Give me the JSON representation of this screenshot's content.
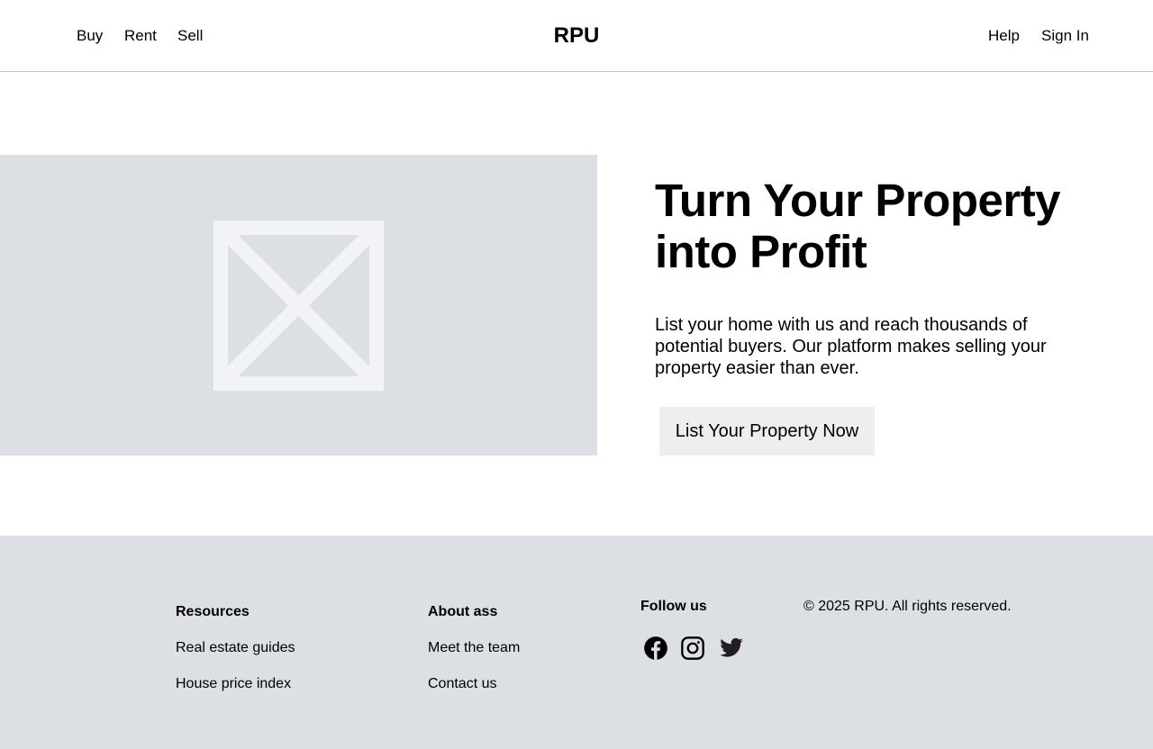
{
  "header": {
    "nav_left": [
      "Buy",
      "Rent",
      "Sell"
    ],
    "logo": "RPU",
    "nav_right": [
      "Help",
      "Sign In"
    ]
  },
  "hero": {
    "image_icon": "image-placeholder-icon",
    "title_line1": "Turn Your Property",
    "title_line2": "into Profit",
    "description": "List your home with us and reach thousands of potential buyers. Our platform makes selling your property easier than ever.",
    "cta_label": "List Your Property Now"
  },
  "footer": {
    "resources": {
      "heading": "Resources",
      "links": [
        "Real estate guides",
        "House price index"
      ]
    },
    "about": {
      "heading": "About ass",
      "links": [
        "Meet the team",
        "Contact us"
      ]
    },
    "follow": {
      "heading": "Follow us",
      "icons": [
        "facebook-icon",
        "instagram-icon",
        "twitter-icon"
      ]
    },
    "copyright": "© 2025 RPU. All rights reserved."
  },
  "colors": {
    "placeholder_bg": "#dcdfe3",
    "footer_bg": "#dcdfe3",
    "button_bg": "#eeeeee"
  }
}
